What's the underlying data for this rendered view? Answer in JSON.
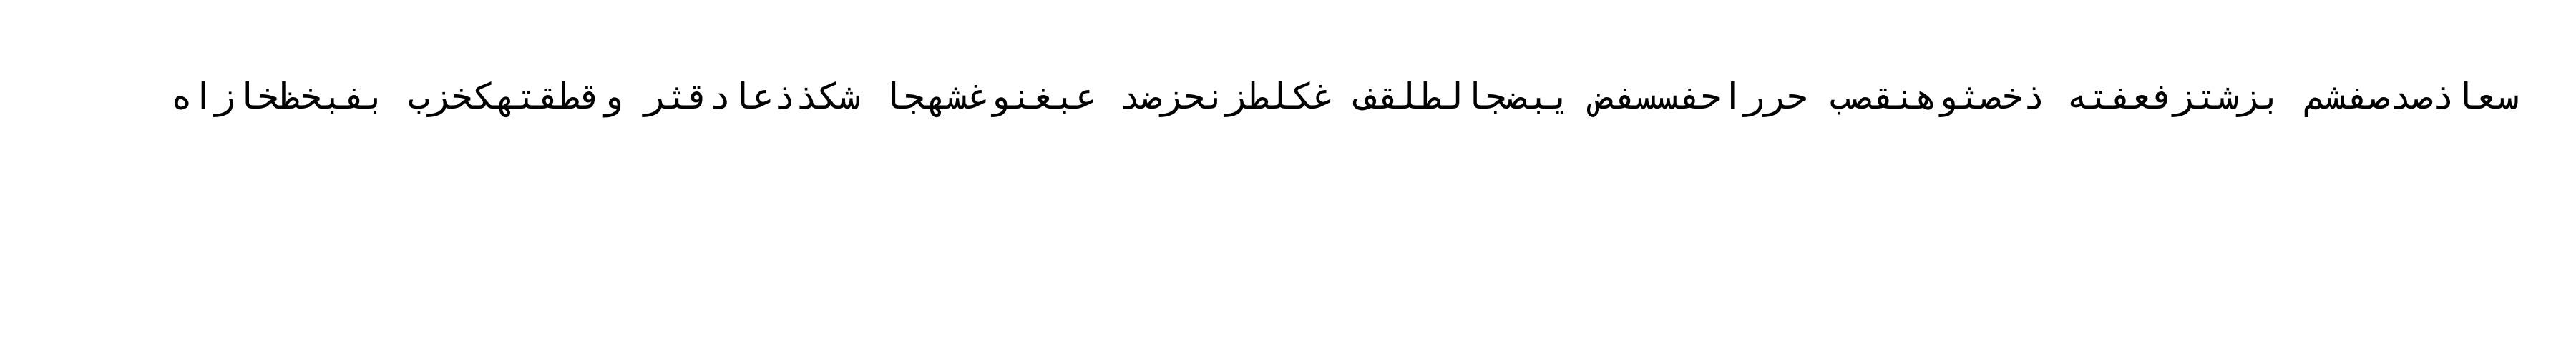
{
  "content": {
    "text": "سعاذصدصفشم بزشتزفعفته ذخصثوهنقصب حرراحفسسفض يبضجالطلقف غكلطزنحزضد عبغنوغشهجا شكذذعادقثر وقطقتهكخزب بفبخظخازاه"
  }
}
